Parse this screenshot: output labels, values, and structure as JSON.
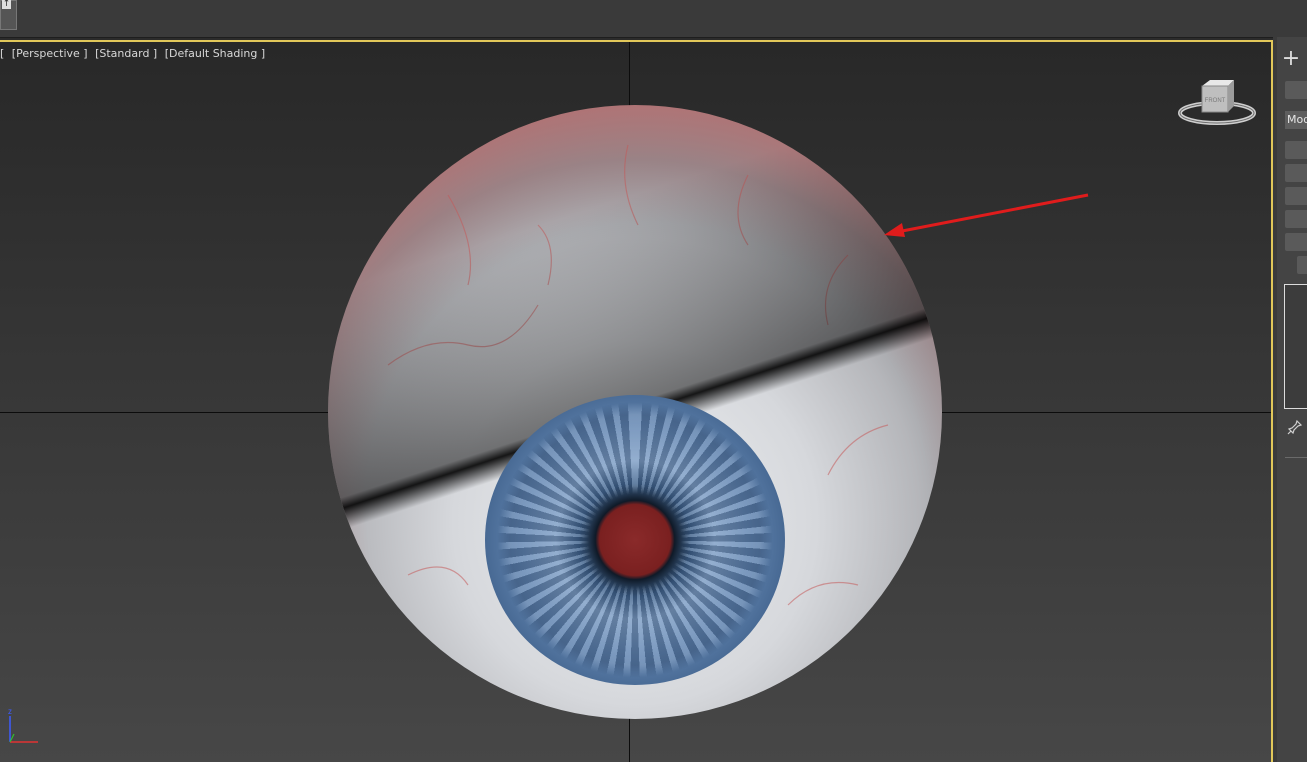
{
  "viewport": {
    "labels": [
      "[",
      "[Perspective ]",
      "[Standard ]",
      "[Default Shading ]"
    ],
    "viewcube_face": "FRONT",
    "axis_label": "z",
    "accent_color": "#e2c85a"
  },
  "command_panel": {
    "create_glyph": "+",
    "modifier_tab_label": "Mod"
  },
  "icons": {
    "toolbar_button": "arrow-up-icon",
    "viewcube": "viewcube-icon",
    "axis": "axis-tripod-icon",
    "pin": "pin-icon",
    "annotation": "red-arrow"
  }
}
